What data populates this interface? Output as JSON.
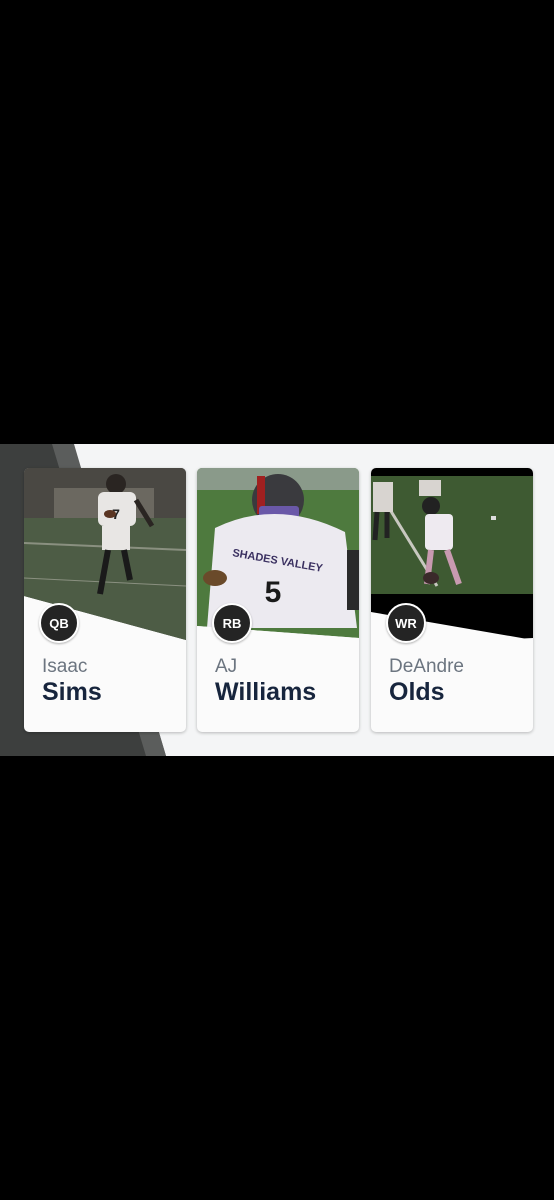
{
  "players": [
    {
      "position": "QB",
      "first_name": "Isaac",
      "last_name": "Sims"
    },
    {
      "position": "RB",
      "first_name": "AJ",
      "last_name": "Williams"
    },
    {
      "position": "WR",
      "first_name": "DeAndre",
      "last_name": "Olds"
    }
  ],
  "colors": {
    "background": "#000000",
    "band": "#f4f5f6",
    "band_accent_dark": "#3d3f3e",
    "badge": "#242424",
    "last_name": "#17253d",
    "first_name": "#6c7580"
  }
}
